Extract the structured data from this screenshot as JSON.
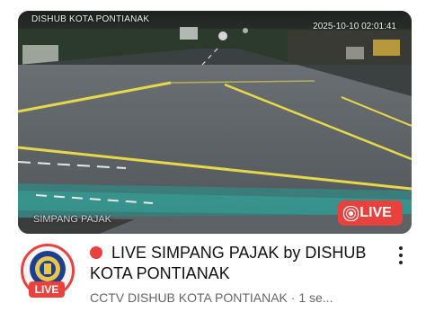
{
  "video": {
    "overlay_title": "DISHUB KOTA PONTIANAK",
    "timestamp": "2025-10-10 02:01:41",
    "location_label": "SIMPANG PAJAK",
    "live_badge": "LIVE",
    "live_icon": "broadcast-icon"
  },
  "channel": {
    "avatar_badge": "LIVE",
    "avatar_icon": "dishub-logo"
  },
  "stream": {
    "title_line": "LIVE SIMPANG PAJAK by DISHUB KOTA PONTIANAK",
    "title_icon": "red-circle-icon",
    "subtitle": "CCTV DISHUB KOTA PONTIANAK · 1 se...",
    "menu_icon": "more-vert-icon"
  },
  "colors": {
    "live_red": "#e8413e",
    "road_marking_yellow": "#e6d84a"
  }
}
